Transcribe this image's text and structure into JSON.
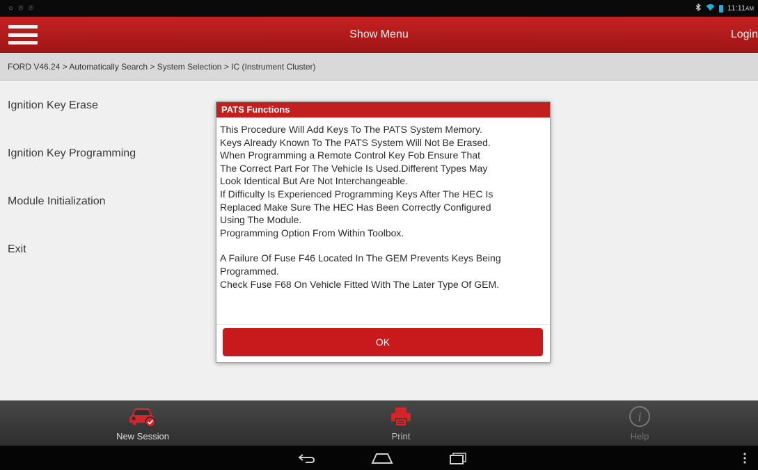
{
  "statusbar": {
    "left_icons": [
      "○",
      "⌾",
      "⌾"
    ],
    "time": "11:11",
    "ampm": "AM"
  },
  "appbar": {
    "title": "Show Menu",
    "login": "Login"
  },
  "breadcrumb": "FORD V46.24 > Automatically Search > System Selection > IC (Instrument Cluster)",
  "menu": {
    "items": [
      {
        "label": "Ignition Key Erase"
      },
      {
        "label": "Ignition Key Programming"
      },
      {
        "label": "Module Initialization"
      },
      {
        "label": "Exit"
      }
    ]
  },
  "dialog": {
    "title": "PATS Functions",
    "lines": [
      "This Procedure Will Add Keys To The PATS System Memory.",
      "Keys Already Known To The PATS System Will Not Be Erased.",
      "When Programming a Remote Control Key Fob Ensure That",
      "The Correct Part For The Vehicle Is Used.Different Types May",
      "Look Identical But Are Not Interchangeable.",
      "If Difficulty Is Experienced Programming Keys After The HEC Is",
      "Replaced Make Sure The HEC Has Been Correctly Configured",
      "Using The Module.",
      "Programming Option From Within Toolbox.",
      "",
      "A Failure Of Fuse F46 Located In The GEM Prevents Keys Being",
      "Programmed.",
      "Check Fuse F68 On Vehicle Fitted With The Later Type Of GEM."
    ],
    "ok_label": "OK"
  },
  "bottombar": {
    "new_session": "New Session",
    "print": "Print",
    "help": "Help"
  },
  "icons": {
    "menu": "hamburger-icon",
    "new_session": "car-check-icon",
    "print": "printer-icon",
    "help": "info-icon",
    "back": "back-arrow-icon",
    "home": "home-icon",
    "recent": "recent-apps-icon",
    "more": "more-vert-icon"
  },
  "colors": {
    "appbar_red": "#b71c1c",
    "dialog_title_red": "#c41f1f",
    "ok_button_red": "#c8191c",
    "new_session_icon": "#d2252a",
    "print_icon": "#d2252a"
  }
}
